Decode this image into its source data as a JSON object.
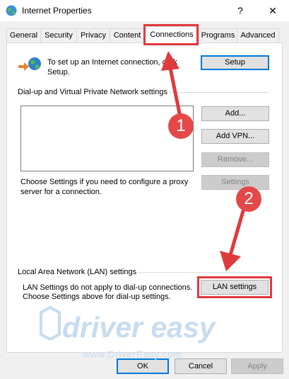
{
  "window": {
    "title": "Internet Properties",
    "help_glyph": "?",
    "close_glyph": "✕"
  },
  "tabs": [
    {
      "label": "General"
    },
    {
      "label": "Security"
    },
    {
      "label": "Privacy"
    },
    {
      "label": "Content"
    },
    {
      "label": "Connections"
    },
    {
      "label": "Programs"
    },
    {
      "label": "Advanced"
    }
  ],
  "active_tab": "Connections",
  "setup": {
    "text_line1": "To set up an Internet connection, click",
    "text_line2": "Setup.",
    "button": "Setup"
  },
  "dialup": {
    "heading": "Dial-up and Virtual Private Network settings",
    "buttons": {
      "add": "Add...",
      "add_vpn": "Add VPN...",
      "remove": "Remove...",
      "settings": "Settings"
    },
    "proxy_line1": "Choose Settings if you need to configure a proxy",
    "proxy_line2": "server for a connection."
  },
  "lan": {
    "heading": "Local Area Network (LAN) settings",
    "line1": "LAN Settings do not apply to dial-up connections.",
    "line2": "Choose Settings above for dial-up settings.",
    "button": "LAN settings"
  },
  "footer": {
    "ok": "OK",
    "cancel": "Cancel",
    "apply": "Apply"
  },
  "annotations": {
    "step1": "1",
    "step2": "2",
    "color": "#e0393e"
  },
  "watermark": {
    "brand": "driver easy",
    "url": "www.DriverEasy.com"
  }
}
